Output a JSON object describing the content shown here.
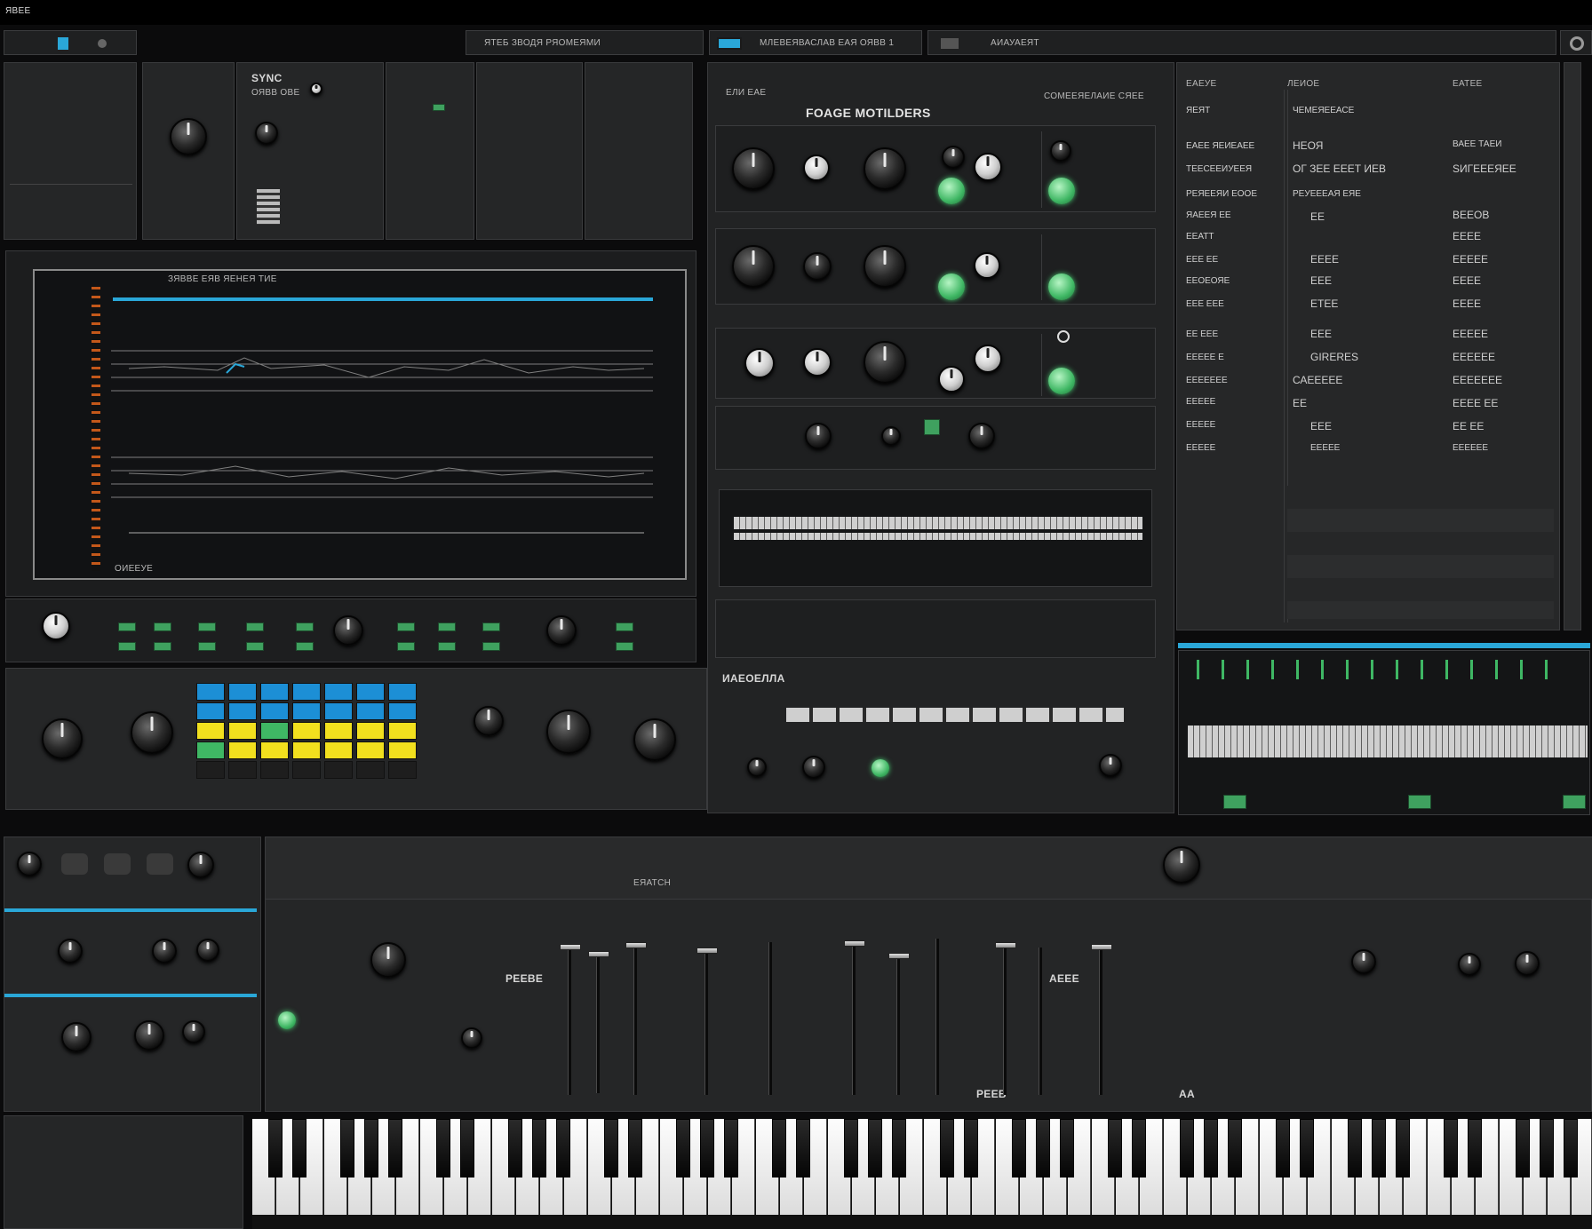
{
  "titlebar": {
    "title": "ЯВЕЕ"
  },
  "tabs": [
    {
      "label": "ЯТЕБ ЗВОДЯ   РЯОМЕЯМИ"
    },
    {
      "label": "МЛЕВЕЯВАСЛАВ ЕАЯ ОЯВВ 1"
    },
    {
      "label": "АИАУАЕЯТ"
    }
  ],
  "osc_panel": {
    "title": "SYNC",
    "sub": "ОЯВВ  ОВЕ"
  },
  "editor": {
    "header": "ЕЛИ ЕАЕ",
    "title": "FOAGE MOTILDERS",
    "subtitle": "СОМЕЕЯЕЛАИЕ СЯЕЕ"
  },
  "display": {
    "header": "ЗЯВВЕ   ЕЯВ ЯЕНЕЯ   ТИЕ",
    "footer": "ОИЕЕУЕ"
  },
  "right_list": {
    "col1_head": "ЕАЕУЕ",
    "col2_head": "ЛЕИОЕ",
    "col3_head": "ЕАТЕЕ",
    "rows": [
      {
        "a": "ЯЕЯТ",
        "b": "ЧЕМЕЯЕЕАСЕ",
        "c": ""
      },
      {
        "a": "ЕАЕЕ ЯЕИЕАЕЕ",
        "b": "НЕОЯ",
        "c": "ВАЕЕ ТАЕИ"
      },
      {
        "a": "ТЕЕСЕЕИУЕЕЯ",
        "b": "ОГ ЗЕЕ ЕЕЕТ ИЕВ",
        "c": "SИГЕЕЕЯЕЕ"
      },
      {
        "a": "РЕЯЕЕЯИ ЕООЕ",
        "b": "РЕУЕЕЕАЯ ЕЯЕ",
        "c": ""
      },
      {
        "a": "ЯАЕЕЯ ЕЕ",
        "b": "ЕЕ",
        "c": "ВЕЕОВ"
      },
      {
        "a": "ЕЕАТТ",
        "b": "ЕЕ",
        "c": "ЕЕЕЕ"
      },
      {
        "a": "ЕЕЕ ЕЕ",
        "b": "ЕЕЕЕ",
        "c": "ЕЕЕЕЕ"
      },
      {
        "a": "ЕЕОЕОЯЕ",
        "b": "ЕЕЕ",
        "c": "ЕЕЕЕ"
      },
      {
        "a": "ЕЕЕ ЕЕЕ",
        "b": "ЕТЕЕ",
        "c": "ЕЕЕЕ"
      },
      {
        "a": "ЕЕ ЕЕЕ",
        "b": "ЕЕЕ",
        "c": "ЕЕЕЕЕ"
      },
      {
        "a": "ЕЕЕЕЕ Е",
        "b": "GIRERES",
        "c": "ЕЕЕЕЕЕ"
      },
      {
        "a": "ЕЕЕЕЕЕЕ",
        "b": "САЕЕЕЕЕ",
        "c": "ЕЕЕЕЕЕЕ"
      },
      {
        "a": "ЕЕЕЕЕ",
        "b": "ЕЕ",
        "c": "ЕЕЕЕ ЕЕ"
      },
      {
        "a": "ЕЕЕЕЕ",
        "b": "ЕЕЕ",
        "c": "ЕЕ ЕЕ"
      },
      {
        "a": "ЕЕЕЕЕ",
        "b": "ЕЕЕЕЕ",
        "c": "ЕЕЕЕЕЕ"
      }
    ]
  },
  "mid_strip": {
    "label": "ИАЕОЕЛЛА"
  },
  "mixer": {
    "left_label": "РЕЕВЕ",
    "right_label": "АЕЕЕ",
    "ch_label": "РЕЕВ",
    "a_label": "АА",
    "catch_label": "ЕЯАТСН"
  },
  "colors": {
    "accent": "#2aa7d8",
    "led": "#46c46e",
    "pad_blue": "#1c8fd6",
    "pad_yellow": "#f2e01e"
  }
}
